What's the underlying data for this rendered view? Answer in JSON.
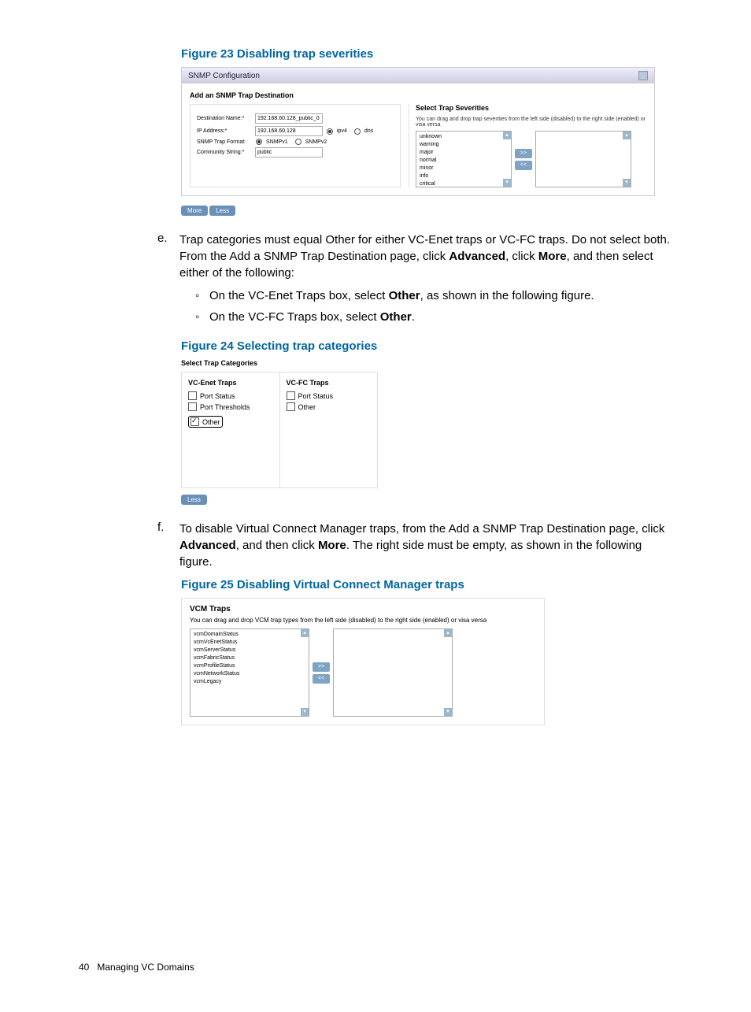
{
  "figure23": {
    "title": "Figure 23 Disabling trap severities",
    "window_title": "SNMP Configuration",
    "section_title": "Add an SNMP Trap Destination",
    "form": {
      "dest_name_label": "Destination Name:*",
      "dest_name_value": "192.168.60.128_public_0",
      "ip_label": "IP Address:*",
      "ip_value": "192.168.60.128",
      "ipv4": "ipv4",
      "dns": "dns",
      "format_label": "SNMP Trap Format:",
      "format_v1": "SNMPv1",
      "format_v2": "SNMPv2",
      "community_label": "Community String:*",
      "community_value": "public"
    },
    "severities": {
      "title": "Select Trap Severities",
      "hint": "You can drag and drop trap severities from the left side (disabled) to the right side (enabled) or visa versa",
      "items": [
        "unknown",
        "warning",
        "major",
        "normal",
        "minor",
        "info",
        "critical"
      ],
      "move_right": ">>",
      "move_left": "<<"
    },
    "more_btn": "More",
    "less_btn": "Less"
  },
  "step_e": {
    "letter": "e.",
    "text_pre": "Trap categories must equal Other for either VC-Enet traps or VC-FC traps. Do not select both. From the Add a SNMP Trap Destination page, click ",
    "advanced": "Advanced",
    "text_mid": ", click ",
    "more": "More",
    "text_post": ", and then select either of the following:",
    "sub1_pre": "On the VC-Enet Traps box, select ",
    "other": "Other",
    "sub1_post": ", as shown in the following figure.",
    "sub2_pre": "On the VC-FC Traps box, select ",
    "sub2_post": "."
  },
  "figure24": {
    "title": "Figure 24 Selecting trap categories",
    "section": "Select Trap Categories",
    "col1_title": "VC-Enet Traps",
    "col2_title": "VC-FC Traps",
    "port_status": "Port Status",
    "port_thresholds": "Port Thresholds",
    "other": "Other",
    "less_btn": "Less"
  },
  "step_f": {
    "letter": "f.",
    "text_pre": "To disable Virtual Connect Manager traps, from the Add a SNMP Trap Destination page, click ",
    "advanced": "Advanced",
    "text_mid": ", and then click ",
    "more": "More",
    "text_post": ". The right side must be empty, as shown in the following figure."
  },
  "figure25": {
    "title": "Figure 25 Disabling Virtual Connect Manager traps",
    "section": "VCM Traps",
    "hint": "You can drag and drop VCM trap types from the left side (disabled) to the right side (enabled) or visa versa",
    "items": [
      "vcmDomainStatus",
      "vcmVcEnetStatus",
      "vcmServerStatus",
      "vcmFabricStatus",
      "vcmProfileStatus",
      "vcmNetworkStatus",
      "vcmLegacy"
    ],
    "move_right": ">>",
    "move_left": "<<"
  },
  "footer": {
    "page": "40",
    "chapter": "Managing VC Domains"
  }
}
